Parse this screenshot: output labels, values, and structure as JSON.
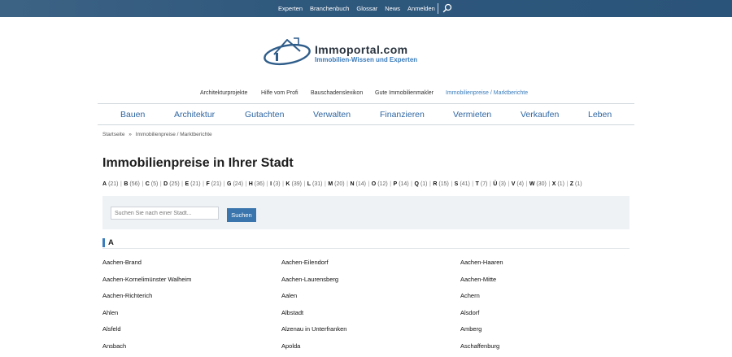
{
  "topnav": {
    "items": [
      "Experten",
      "Branchenbuch",
      "Glossar",
      "News",
      "Anmelden"
    ]
  },
  "brand": {
    "name": "Immoportal.com",
    "tagline": "Immobilien-Wissen und Experten",
    "accent": "#3a7cbc",
    "topbar_color": "#2f587d"
  },
  "subnav": {
    "items": [
      "Architekturprojekte",
      "Hilfe vom Profi",
      "Bauschadenslexikon",
      "Gute Immobilienmakler",
      "Immobilienpreise / Marktberichte"
    ],
    "active": "Immobilienpreise / Marktberichte"
  },
  "mainnav": {
    "items": [
      "Bauen",
      "Architektur",
      "Gutachten",
      "Verwalten",
      "Finanzieren",
      "Vermieten",
      "Verkaufen",
      "Leben"
    ]
  },
  "breadcrumb": {
    "home": "Startseite",
    "sep": "»",
    "current": "Immobilienpreise / Marktberichte"
  },
  "page": {
    "title": "Immobilienpreise in Ihrer Stadt"
  },
  "alphabet": [
    {
      "letter": "A",
      "count": "(21)"
    },
    {
      "letter": "B",
      "count": "(56)"
    },
    {
      "letter": "C",
      "count": "(5)"
    },
    {
      "letter": "D",
      "count": "(25)"
    },
    {
      "letter": "E",
      "count": "(21)"
    },
    {
      "letter": "F",
      "count": "(21)"
    },
    {
      "letter": "G",
      "count": "(24)"
    },
    {
      "letter": "H",
      "count": "(36)"
    },
    {
      "letter": "I",
      "count": "(3)"
    },
    {
      "letter": "K",
      "count": "(39)"
    },
    {
      "letter": "L",
      "count": "(31)"
    },
    {
      "letter": "M",
      "count": "(20)"
    },
    {
      "letter": "N",
      "count": "(14)"
    },
    {
      "letter": "O",
      "count": "(12)"
    },
    {
      "letter": "P",
      "count": "(14)"
    },
    {
      "letter": "Q",
      "count": "(1)"
    },
    {
      "letter": "R",
      "count": "(15)"
    },
    {
      "letter": "S",
      "count": "(41)"
    },
    {
      "letter": "T",
      "count": "(7)"
    },
    {
      "letter": "Ü",
      "count": "(3)"
    },
    {
      "letter": "V",
      "count": "(4)"
    },
    {
      "letter": "W",
      "count": "(30)"
    },
    {
      "letter": "X",
      "count": "(1)"
    },
    {
      "letter": "Z",
      "count": "(1)"
    }
  ],
  "search": {
    "placeholder": "Suchen Sie nach einer Stadt...",
    "value": "",
    "button": "Suchen"
  },
  "section": {
    "letter": "A"
  },
  "cities": [
    [
      "Aachen-Brand",
      "Aachen-Eilendorf",
      "Aachen-Haaren"
    ],
    [
      "Aachen-Kornelimünster Walheim",
      "Aachen-Laurensberg",
      "Aachen-Mitte"
    ],
    [
      "Aachen-Richterich",
      "Aalen",
      "Achern"
    ],
    [
      "Ahlen",
      "Albstadt",
      "Alsdorf"
    ],
    [
      "Alsfeld",
      "Alzenau in Unterfranken",
      "Amberg"
    ],
    [
      "Ansbach",
      "Apolda",
      "Aschaffenburg"
    ]
  ]
}
